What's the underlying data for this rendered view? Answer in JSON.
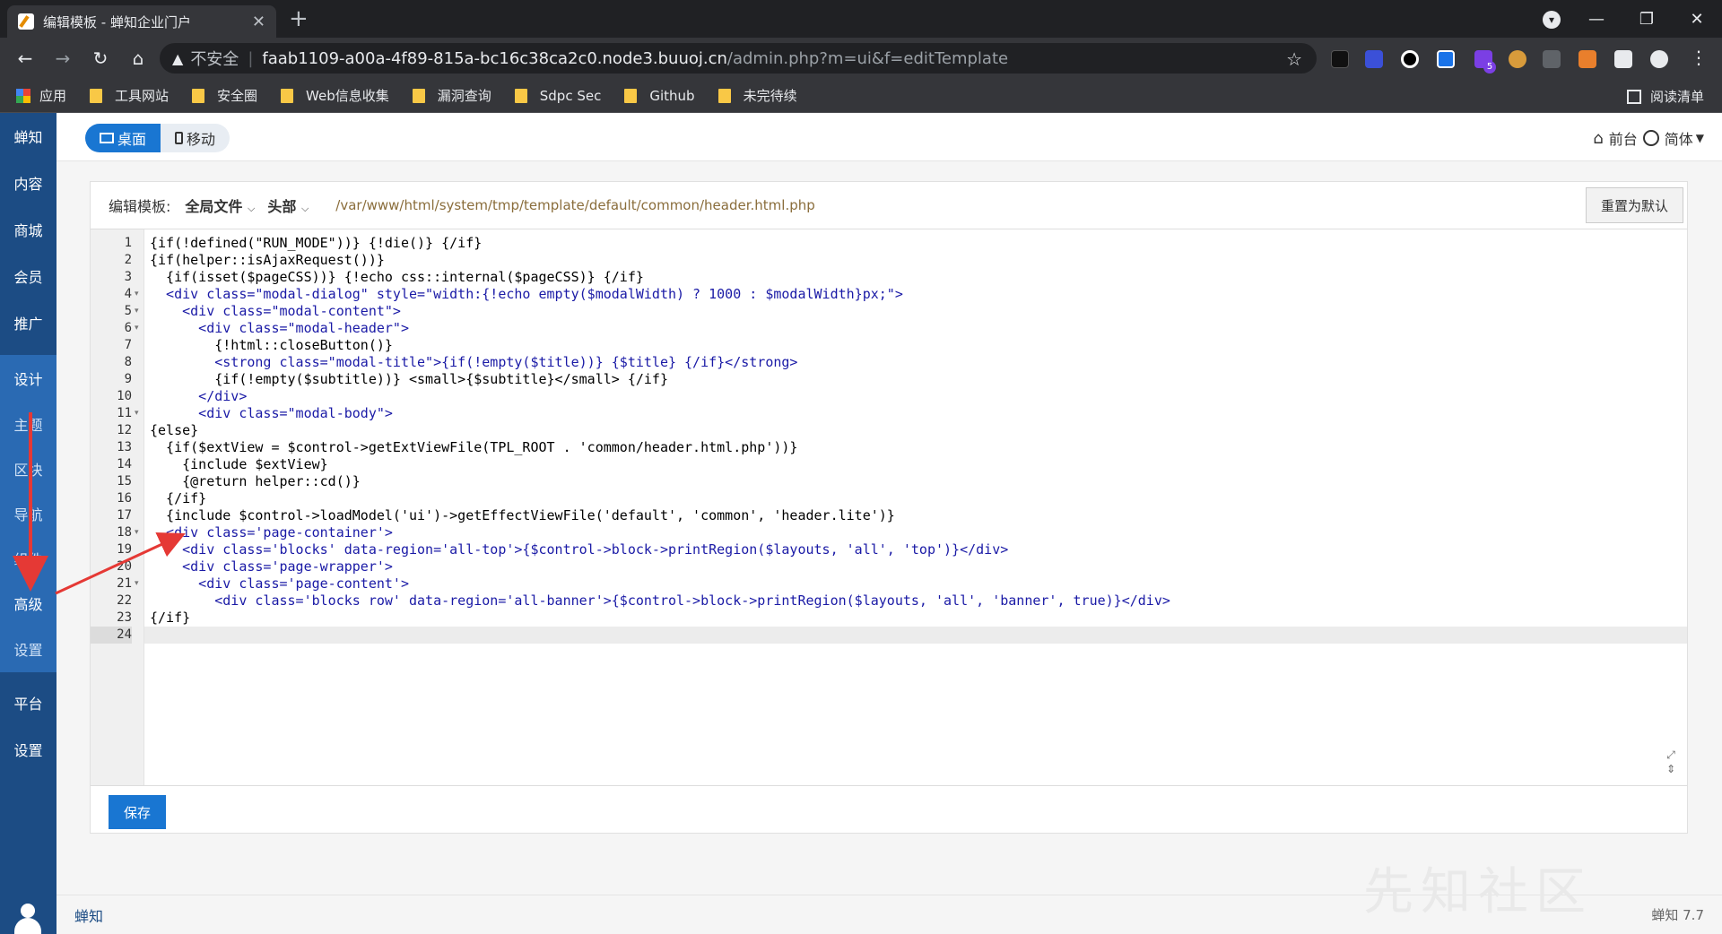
{
  "browser": {
    "tab_title": "编辑模板 - 蝉知企业门户",
    "address_insecure": "不安全",
    "address_host": "faab1109-a00a-4f89-815a-bc16c38ca2c0.node3.buuoj.cn",
    "address_path": "/admin.php?m=ui&f=editTemplate",
    "extension_badge": "5",
    "bookmarks": [
      "应用",
      "工具网站",
      "安全圈",
      "Web信息收集",
      "漏洞查询",
      "Sdpc Sec",
      "Github",
      "未完待续"
    ],
    "reading_list": "阅读清单"
  },
  "sidebar": {
    "items": [
      "蝉知",
      "内容",
      "商城",
      "会员",
      "推广",
      "设计",
      "主题",
      "区块",
      "导航",
      "组件",
      "高级",
      "设置",
      "平台",
      "设置"
    ]
  },
  "topbar": {
    "desktop": "桌面",
    "mobile": "移动",
    "front": "前台",
    "lang": "简体"
  },
  "editor": {
    "label": "编辑模板:",
    "scope": "全局文件",
    "part": "头部",
    "path": "/var/www/html/system/tmp/template/default/common/header.html.php",
    "reset": "重置为默认",
    "save": "保存",
    "lines": [
      "{if(!defined(\"RUN_MODE\"))} {!die()} {/if}",
      "{if(helper::isAjaxRequest())}",
      "  {if(isset($pageCSS))} {!echo css::internal($pageCSS)} {/if}",
      "  <div class=\"modal-dialog\" style=\"width:{!echo empty($modalWidth) ? 1000 : $modalWidth}px;\">",
      "    <div class=\"modal-content\">",
      "      <div class=\"modal-header\">",
      "        {!html::closeButton()}",
      "        <strong class=\"modal-title\">{if(!empty($title))} {$title} {/if}</strong>",
      "        {if(!empty($subtitle))} <small>{$subtitle}</small> {/if}",
      "      </div>",
      "      <div class=\"modal-body\">",
      "{else}",
      "  {if($extView = $control->getExtViewFile(TPL_ROOT . 'common/header.html.php'))}",
      "    {include $extView}",
      "    {@return helper::cd()}",
      "  {/if}",
      "  {include $control->loadModel('ui')->getEffectViewFile('default', 'common', 'header.lite')}",
      "  <div class='page-container'>",
      "    <div class='blocks' data-region='all-top'>{$control->block->printRegion($layouts, 'all', 'top')}</div>",
      "    <div class='page-wrapper'>",
      "      <div class='page-content'>",
      "        <div class='blocks row' data-region='all-banner'>{$control->block->printRegion($layouts, 'all', 'banner', true)}</div>",
      "{/if}",
      ""
    ],
    "folds": [
      4,
      5,
      6,
      11,
      18,
      21
    ]
  },
  "footer": {
    "brand": "蝉知",
    "version": "蝉知 7.7"
  },
  "watermark": "先知社区"
}
